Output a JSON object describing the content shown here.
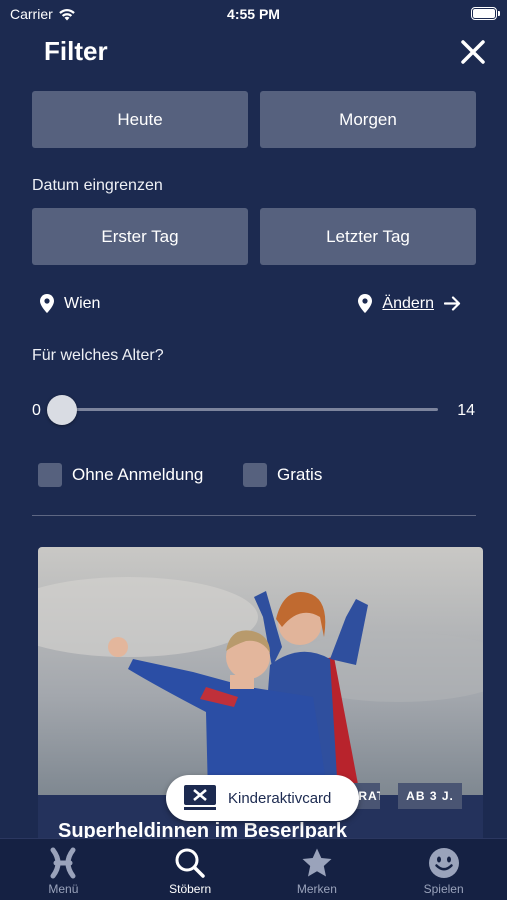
{
  "status": {
    "carrier": "Carrier",
    "time": "4:55 PM"
  },
  "header": {
    "title": "Filter"
  },
  "quick_dates": {
    "today": "Heute",
    "tomorrow": "Morgen"
  },
  "date_range": {
    "label": "Datum eingrenzen",
    "first_day": "Erster Tag",
    "last_day": "Letzter Tag"
  },
  "location": {
    "city": "Wien",
    "change_label": "Ändern"
  },
  "age": {
    "label": "Für welches Alter?",
    "min": "0",
    "max": "14",
    "selected_from": 0
  },
  "options": {
    "no_registration": "Ohne Anmeldung",
    "free": "Gratis"
  },
  "card": {
    "title": "Superheldinnen im Beserlpark",
    "tags": [
      "GRATIS",
      "AB 3 J."
    ]
  },
  "pill": {
    "label": "Kinderaktivcard"
  },
  "tabs": [
    {
      "label": "Menü",
      "icon": "x-logo-icon"
    },
    {
      "label": "Stöbern",
      "icon": "search-icon"
    },
    {
      "label": "Merken",
      "icon": "star-icon"
    },
    {
      "label": "Spielen",
      "icon": "smiley-icon"
    }
  ],
  "colors": {
    "background": "#1c2a50",
    "button": "#56617e",
    "tabbar": "#152143"
  }
}
